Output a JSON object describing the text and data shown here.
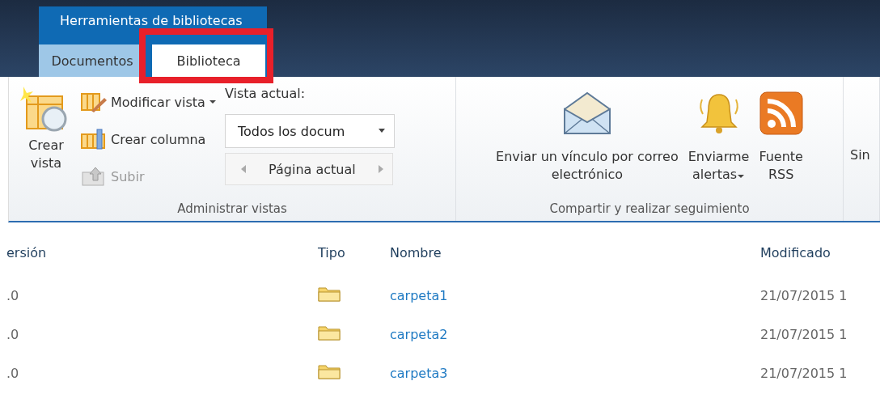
{
  "contextual_group": {
    "title": "Herramientas de bibliotecas"
  },
  "tabs": [
    {
      "label": "Documentos",
      "selected": false,
      "highlighted": false
    },
    {
      "label": "Biblioteca",
      "selected": true,
      "highlighted": true
    }
  ],
  "ribbon": {
    "groups": [
      {
        "label": "Administrar vistas",
        "create_view": {
          "label_1": "Crear",
          "label_2": "vista"
        },
        "small_buttons": [
          {
            "label": "Modificar vista",
            "kind": "modify",
            "dropdown": true,
            "disabled": false
          },
          {
            "label": "Crear columna",
            "kind": "column",
            "dropdown": false,
            "disabled": false
          },
          {
            "label": "Subir",
            "kind": "up",
            "dropdown": false,
            "disabled": true
          }
        ],
        "current_view": {
          "label": "Vista actual:",
          "value": "Todos los docum",
          "page": "Página actual"
        }
      },
      {
        "label": "Compartir y realizar seguimiento",
        "buttons": [
          {
            "kind": "email",
            "label_1": "Enviar un vínculo por correo",
            "label_2": "electrónico",
            "dropdown": false
          },
          {
            "kind": "alert",
            "label_1": "Enviarme",
            "label_2": "alertas",
            "dropdown": true
          },
          {
            "kind": "rss",
            "label_1": "Fuente",
            "label_2": "RSS",
            "dropdown": false
          }
        ]
      },
      {
        "buttons": [
          {
            "kind": "cut",
            "label_1": "Sin"
          }
        ]
      }
    ]
  },
  "table": {
    "columns": [
      "ersión",
      "Tipo",
      "Nombre",
      "Modificado"
    ],
    "rows": [
      {
        "version": ".0",
        "name": "carpeta1",
        "modified": "21/07/2015 1"
      },
      {
        "version": ".0",
        "name": "carpeta2",
        "modified": "21/07/2015 1"
      },
      {
        "version": ".0",
        "name": "carpeta3",
        "modified": "21/07/2015 1"
      }
    ]
  }
}
